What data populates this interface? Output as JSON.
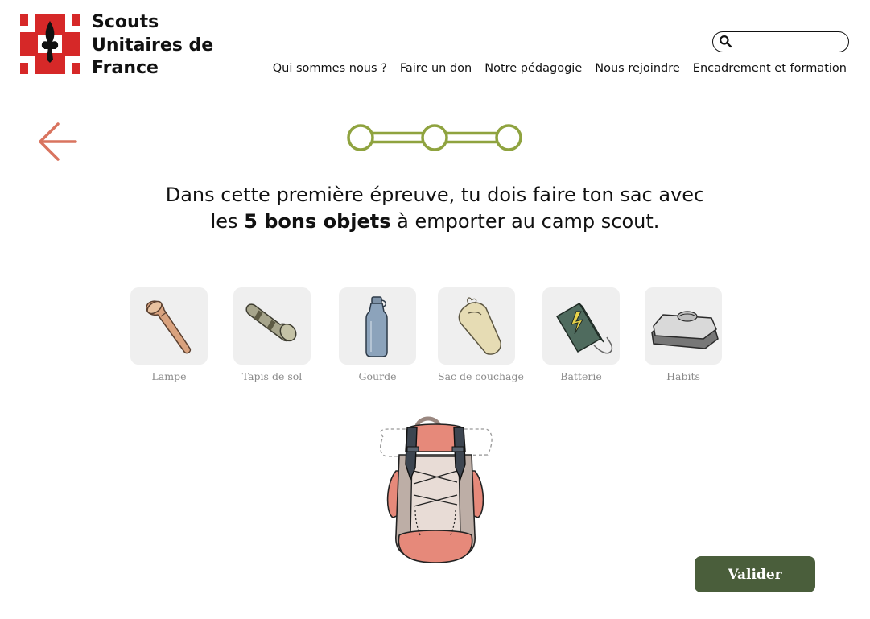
{
  "header": {
    "brand": [
      "Scouts",
      "Unitaires de",
      "France"
    ],
    "search": {
      "placeholder": "",
      "value": ""
    },
    "nav": [
      "Qui sommes nous ?",
      "Faire un don",
      "Notre pédagogie",
      "Nous rejoindre",
      "Encadrement et formation"
    ]
  },
  "stepper": {
    "total_steps": 3,
    "current_step": 1
  },
  "instruction": {
    "line1": "Dans cette première épreuve, tu dois faire ton sac avec",
    "line2_before": "les ",
    "line2_bold": "5 bons objets",
    "line2_after": " à emporter au camp scout."
  },
  "items": [
    {
      "label": "Lampe",
      "icon": "flashlight-icon"
    },
    {
      "label": "Tapis de sol",
      "icon": "sleeping-mat-icon"
    },
    {
      "label": "Gourde",
      "icon": "water-bottle-icon"
    },
    {
      "label": "Sac de couchage",
      "icon": "sleeping-bag-icon"
    },
    {
      "label": "Batterie",
      "icon": "power-bank-icon"
    },
    {
      "label": "Habits",
      "icon": "clothes-icon"
    }
  ],
  "actions": {
    "validate_label": "Valider"
  },
  "colors": {
    "accent_green": "#8fa33f",
    "button_green": "#4a5e3b",
    "arrow_salmon": "#d9745f",
    "brand_red": "#d62828",
    "tile_bg": "#efefef"
  }
}
